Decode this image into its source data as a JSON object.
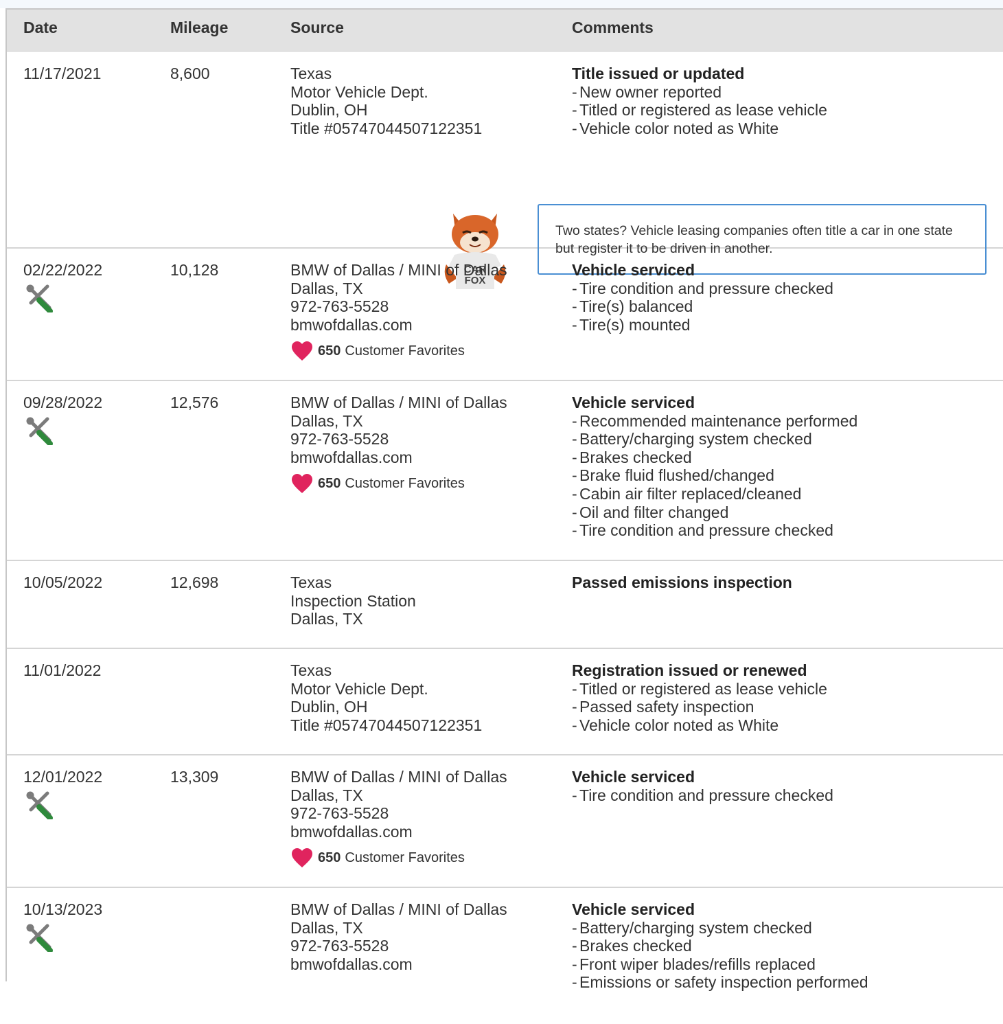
{
  "table": {
    "headers": {
      "date": "Date",
      "mileage": "Mileage",
      "source": "Source",
      "comments": "Comments"
    }
  },
  "rows": [
    {
      "date": "11/17/2021",
      "mileage": "8,600",
      "source": [
        "Texas",
        "Motor Vehicle Dept.",
        "Dublin, OH",
        "Title #05747044507122351"
      ],
      "comment_title": "Title issued or updated",
      "comments": [
        "New owner reported",
        "Titled or registered as lease vehicle",
        "Vehicle color noted as White"
      ],
      "tip": "Two states? Vehicle leasing companies often title a car in one state but register it to be driven in another.",
      "mascot_text": [
        "CAR",
        "FOX"
      ]
    },
    {
      "date": "02/22/2022",
      "mileage": "10,128",
      "icon": "service-wrench-icon",
      "source": [
        "BMW of Dallas / MINI of Dallas",
        "Dallas, TX",
        "972-763-5528",
        "bmwofdallas.com"
      ],
      "favorites_count": "650",
      "favorites_label": "Customer Favorites",
      "comment_title": "Vehicle serviced",
      "comments": [
        "Tire condition and pressure checked",
        "Tire(s) balanced",
        "Tire(s) mounted"
      ]
    },
    {
      "date": "09/28/2022",
      "mileage": "12,576",
      "icon": "service-wrench-icon",
      "source": [
        "BMW of Dallas / MINI of Dallas",
        "Dallas, TX",
        "972-763-5528",
        "bmwofdallas.com"
      ],
      "favorites_count": "650",
      "favorites_label": "Customer Favorites",
      "comment_title": "Vehicle serviced",
      "comments": [
        "Recommended maintenance performed",
        "Battery/charging system checked",
        "Brakes checked",
        "Brake fluid flushed/changed",
        "Cabin air filter replaced/cleaned",
        "Oil and filter changed",
        "Tire condition and pressure checked"
      ]
    },
    {
      "date": "10/05/2022",
      "mileage": "12,698",
      "source": [
        "Texas",
        "Inspection Station",
        "Dallas, TX"
      ],
      "comment_title": "Passed emissions inspection",
      "comments": []
    },
    {
      "date": "11/01/2022",
      "mileage": "",
      "source": [
        "Texas",
        "Motor Vehicle Dept.",
        "Dublin, OH",
        "Title #05747044507122351"
      ],
      "comment_title": "Registration issued or renewed",
      "comments": [
        "Titled or registered as lease vehicle",
        "Passed safety inspection",
        "Vehicle color noted as White"
      ]
    },
    {
      "date": "12/01/2022",
      "mileage": "13,309",
      "icon": "service-wrench-icon",
      "source": [
        "BMW of Dallas / MINI of Dallas",
        "Dallas, TX",
        "972-763-5528",
        "bmwofdallas.com"
      ],
      "favorites_count": "650",
      "favorites_label": "Customer Favorites",
      "comment_title": "Vehicle serviced",
      "comments": [
        "Tire condition and pressure checked"
      ]
    },
    {
      "date": "10/13/2023",
      "mileage": "",
      "icon": "service-wrench-icon",
      "source": [
        "BMW of Dallas / MINI of Dallas",
        "Dallas, TX",
        "972-763-5528",
        "bmwofdallas.com"
      ],
      "comment_title": "Vehicle serviced",
      "comments": [
        "Battery/charging system checked",
        "Brakes checked",
        "Front wiper blades/refills replaced",
        "Emissions or safety inspection performed"
      ]
    }
  ],
  "colors": {
    "header_bg": "#e2e2e2",
    "heart": "#e0245e",
    "wrench_green": "#2f8a3c",
    "tip_border": "#4a8fd3"
  }
}
